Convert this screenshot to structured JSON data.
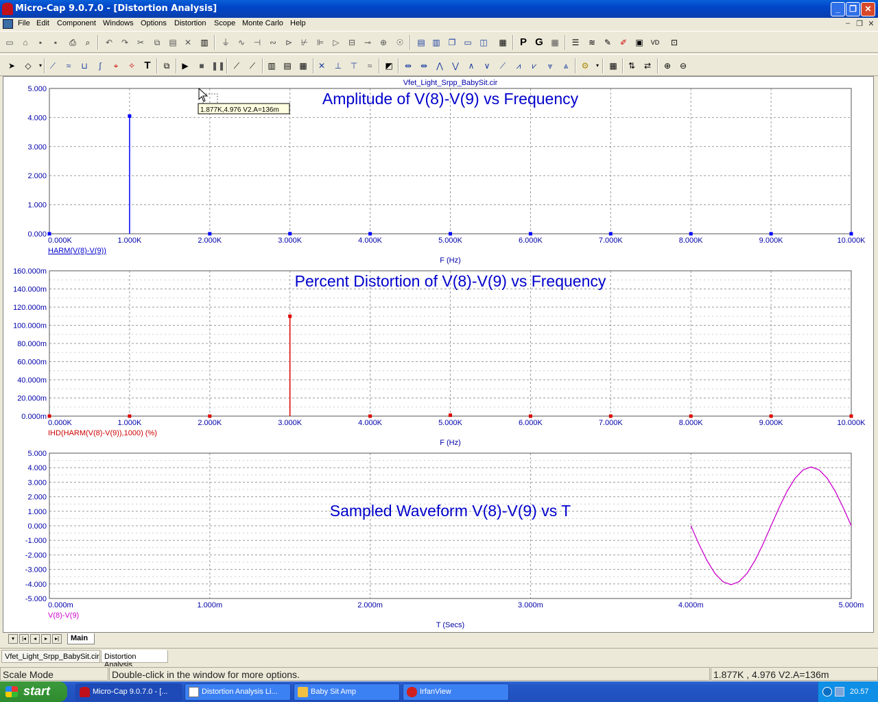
{
  "window": {
    "title": "Micro-Cap 9.0.7.0 - [Distortion Analysis]",
    "min_glyph": "_",
    "max_glyph": "❐",
    "close_glyph": "✕"
  },
  "menu": {
    "items": [
      "File",
      "Edit",
      "Component",
      "Windows",
      "Options",
      "Distortion",
      "Scope",
      "Monte Carlo",
      "Help"
    ]
  },
  "plot": {
    "filename": "Vfet_Light_Srpp_BabySit.cir",
    "cursor_label": "1.877K,4.976 V2.A=136m",
    "panels": [
      {
        "title": "Amplitude of V(8)-V(9) vs Frequency",
        "expr": "HARM(V(8)-V(9))",
        "xlabel": "F (Hz)",
        "yticks": [
          "5.000",
          "4.000",
          "3.000",
          "2.000",
          "1.000",
          "0.000"
        ],
        "xticks": [
          "0.000K",
          "1.000K",
          "2.000K",
          "3.000K",
          "4.000K",
          "5.000K",
          "6.000K",
          "7.000K",
          "8.000K",
          "9.000K",
          "10.000K"
        ]
      },
      {
        "title": "Percent Distortion of V(8)-V(9) vs Frequency",
        "expr": "IHD(HARM(V(8)-V(9)),1000) (%)",
        "xlabel": "F (Hz)",
        "yticks": [
          "160.000m",
          "140.000m",
          "120.000m",
          "100.000m",
          "80.000m",
          "60.000m",
          "40.000m",
          "20.000m",
          "0.000m"
        ],
        "xticks": [
          "0.000K",
          "1.000K",
          "2.000K",
          "3.000K",
          "4.000K",
          "5.000K",
          "6.000K",
          "7.000K",
          "8.000K",
          "9.000K",
          "10.000K"
        ]
      },
      {
        "title": "Sampled Waveform  V(8)-V(9) vs T",
        "expr": "V(8)-V(9)",
        "xlabel": "T (Secs)",
        "yticks": [
          "5.000",
          "4.000",
          "3.000",
          "2.000",
          "1.000",
          "0.000",
          "-1.000",
          "-2.000",
          "-3.000",
          "-4.000",
          "-5.000"
        ],
        "xticks": [
          "0.000m",
          "1.000m",
          "2.000m",
          "3.000m",
          "4.000m",
          "5.000m"
        ]
      }
    ]
  },
  "chart_data": [
    {
      "type": "bar",
      "title": "Amplitude of V(8)-V(9) vs Frequency",
      "xlabel": "F (Hz)",
      "ylabel": "HARM(V(8)-V(9))",
      "xlim": [
        0,
        10000
      ],
      "ylim": [
        0,
        5
      ],
      "series": [
        {
          "name": "HARM(V(8)-V(9))",
          "color": "#0000ff",
          "x": [
            0,
            1000,
            2000,
            3000,
            4000,
            5000,
            6000,
            7000,
            8000,
            9000,
            10000
          ],
          "values": [
            0,
            4.05,
            0,
            0.003,
            0,
            0,
            0,
            0,
            0,
            0,
            0
          ]
        }
      ],
      "grid": true
    },
    {
      "type": "bar",
      "title": "Percent Distortion of V(8)-V(9) vs Frequency",
      "xlabel": "F (Hz)",
      "ylabel": "IHD(HARM(V(8)-V(9)),1000) (%)",
      "xlim": [
        0,
        10000
      ],
      "ylim": [
        0,
        0.16
      ],
      "series": [
        {
          "name": "IHD(HARM(V(8)-V(9)),1000) (%)",
          "color": "#dd0000",
          "x": [
            0,
            1000,
            2000,
            3000,
            4000,
            5000,
            6000,
            7000,
            8000,
            9000,
            10000
          ],
          "values": [
            0,
            0,
            0,
            0.11,
            0,
            0.001,
            0,
            0,
            0,
            0,
            0
          ]
        }
      ],
      "grid": true
    },
    {
      "type": "line",
      "title": "Sampled Waveform  V(8)-V(9) vs T",
      "xlabel": "T (Secs)",
      "ylabel": "V(8)-V(9)",
      "xlim": [
        0,
        0.005
      ],
      "ylim": [
        -5,
        5
      ],
      "series": [
        {
          "name": "V(8)-V(9)",
          "color": "#cc00cc",
          "x": [
            0.004,
            0.00405,
            0.0041,
            0.00415,
            0.0042,
            0.00425,
            0.0043,
            0.00435,
            0.0044,
            0.00445,
            0.0045,
            0.00455,
            0.0046,
            0.00465,
            0.0047,
            0.00475,
            0.0048,
            0.00485,
            0.0049,
            0.00495,
            0.005
          ],
          "values": [
            0,
            -1.25,
            -2.38,
            -3.28,
            -3.85,
            -4.05,
            -3.85,
            -3.28,
            -2.38,
            -1.25,
            0,
            1.25,
            2.38,
            3.28,
            3.85,
            4.05,
            3.85,
            3.28,
            2.38,
            1.25,
            0
          ]
        }
      ],
      "grid": true
    }
  ],
  "tabs": {
    "sheet": "Main",
    "documents": [
      "Vfet_Light_Srpp_BabySit.cir",
      "Distortion Analysis"
    ]
  },
  "status": {
    "mode": "Scale Mode",
    "hint": "Double-click in the window for more options.",
    "cursor": "1.877K , 4.976  V2.A=136m"
  },
  "taskbar": {
    "start": "start",
    "tasks": [
      "Micro-Cap 9.0.7.0 - [...",
      "Distortion Analysis Li...",
      "Baby Sit Amp",
      "IrfanView"
    ],
    "clock": "20.57"
  }
}
